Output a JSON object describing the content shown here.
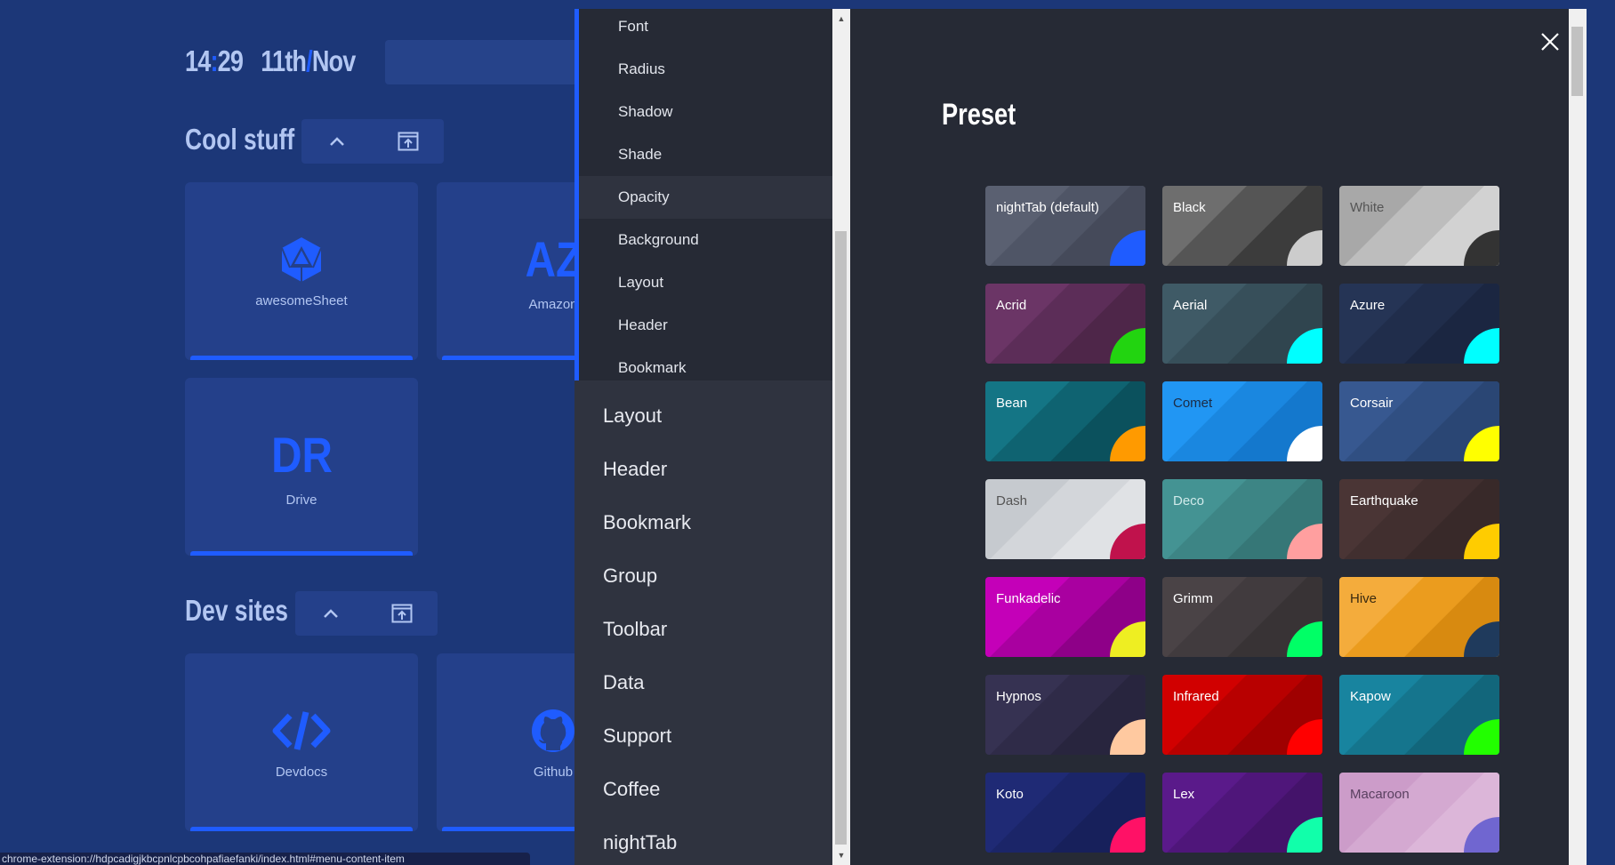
{
  "clock": {
    "hours": "14",
    "separator": ":",
    "minutes": "29",
    "day": "11th",
    "date_separator": "/",
    "month": "Nov"
  },
  "groups": [
    {
      "title": "Cool stuff",
      "bookmarks": [
        {
          "name": "awesomeSheet",
          "letters": "",
          "icon": "d20-icon"
        },
        {
          "name": "Amazon",
          "letters": "AZ",
          "icon": ""
        },
        {
          "name": "Drive",
          "letters": "DR",
          "icon": ""
        }
      ]
    },
    {
      "title": "Dev sites",
      "bookmarks": [
        {
          "name": "Devdocs",
          "letters": "",
          "icon": "code-icon"
        },
        {
          "name": "Github",
          "letters": "",
          "icon": "github-icon"
        }
      ]
    }
  ],
  "status_url": "chrome-extension://hdpcadigjkbcpnlcpbcohpafiaefanki/index.html#menu-content-item",
  "menu": {
    "sub_items": [
      "Font",
      "Radius",
      "Shadow",
      "Shade",
      "Opacity",
      "Background",
      "Layout",
      "Header",
      "Bookmark"
    ],
    "active_sub_item": "Opacity",
    "main_items": [
      "Layout",
      "Header",
      "Bookmark",
      "Group",
      "Toolbar",
      "Data",
      "Support",
      "Coffee",
      "nightTab"
    ],
    "section_title": "Preset",
    "close_icon": "close-icon"
  },
  "presets": [
    {
      "name": "nightTab (default)",
      "text": "#ffffff",
      "colors": [
        "#5a6071",
        "#4f5566",
        "#454a5a",
        "#3b4050"
      ],
      "accent": "#1f5cff"
    },
    {
      "name": "Black",
      "text": "#ffffff",
      "colors": [
        "#6e6e6e",
        "#555555",
        "#3c3c3c",
        "#222222"
      ],
      "accent": "#cccccc"
    },
    {
      "name": "White",
      "text": "#555555",
      "colors": [
        "#a8a8a8",
        "#bdbdbd",
        "#d2d2d2",
        "#e7e7e7"
      ],
      "accent": "#333333"
    },
    {
      "name": "Acrid",
      "text": "#ffffff",
      "colors": [
        "#6b3566",
        "#5c2d58",
        "#4e2649",
        "#40203c"
      ],
      "accent": "#22d410"
    },
    {
      "name": "Aerial",
      "text": "#ffffff",
      "colors": [
        "#3f5a66",
        "#374f5a",
        "#30454f",
        "#283a43"
      ],
      "accent": "#00ffff"
    },
    {
      "name": "Azure",
      "text": "#ffffff",
      "colors": [
        "#253455",
        "#202d4b",
        "#1b2641",
        "#161f36"
      ],
      "accent": "#00ffff"
    },
    {
      "name": "Bean",
      "text": "#ffffff",
      "colors": [
        "#147585",
        "#0f6371",
        "#0b515d",
        "#073f49"
      ],
      "accent": "#ff9a00"
    },
    {
      "name": "Comet",
      "text": "#1c2b44",
      "colors": [
        "#2196f3",
        "#1a87e0",
        "#1478cd",
        "#0e69ba"
      ],
      "accent": "#ffffff"
    },
    {
      "name": "Corsair",
      "text": "#ffffff",
      "colors": [
        "#375890",
        "#304f82",
        "#2a4674",
        "#243d66"
      ],
      "accent": "#ffff00"
    },
    {
      "name": "Dash",
      "text": "#555555",
      "colors": [
        "#c6cacf",
        "#d3d6da",
        "#e0e2e5",
        "#edeef0"
      ],
      "accent": "#c0124c"
    },
    {
      "name": "Deco",
      "text": "#d0eaea",
      "colors": [
        "#449393",
        "#3d8585",
        "#367777",
        "#2f6969"
      ],
      "accent": "#ff9f9f"
    },
    {
      "name": "Earthquake",
      "text": "#ffffff",
      "colors": [
        "#4a3535",
        "#412f2f",
        "#382929",
        "#2f2323"
      ],
      "accent": "#ffcc00"
    },
    {
      "name": "Funkadelic",
      "text": "#ffffff",
      "colors": [
        "#c400b8",
        "#a900a0",
        "#8e0088",
        "#730070"
      ],
      "accent": "#eeee22"
    },
    {
      "name": "Grimm",
      "text": "#ffffff",
      "colors": [
        "#4a4346",
        "#413b3e",
        "#383335",
        "#2f2b2d"
      ],
      "accent": "#00ff66"
    },
    {
      "name": "Hive",
      "text": "#3a2a10",
      "colors": [
        "#f4ac3c",
        "#eb9c1e",
        "#d88a10",
        "#b87512"
      ],
      "accent": "#1f3a5c"
    },
    {
      "name": "Hypnos",
      "text": "#ffffff",
      "colors": [
        "#363252",
        "#2f2b48",
        "#28253e",
        "#211f34"
      ],
      "accent": "#ffc9a0"
    },
    {
      "name": "Infrared",
      "text": "#ffffff",
      "colors": [
        "#d10000",
        "#b80000",
        "#9f0000",
        "#860000"
      ],
      "accent": "#ff0000"
    },
    {
      "name": "Kapow",
      "text": "#ffffff",
      "colors": [
        "#18849f",
        "#15758d",
        "#12667b",
        "#0f5769"
      ],
      "accent": "#22ff00"
    },
    {
      "name": "Koto",
      "text": "#ffffff",
      "colors": [
        "#1f2a75",
        "#1b2568",
        "#17205b",
        "#131b4e"
      ],
      "accent": "#ff1166"
    },
    {
      "name": "Lex",
      "text": "#ffffff",
      "colors": [
        "#5a1a8a",
        "#4f167a",
        "#44136a",
        "#39105a"
      ],
      "accent": "#11ffaa"
    },
    {
      "name": "Macaroon",
      "text": "#5a4060",
      "colors": [
        "#cc9cc9",
        "#d4a9d1",
        "#dcb6d9",
        "#e4c3e1"
      ],
      "accent": "#7066d0"
    }
  ]
}
